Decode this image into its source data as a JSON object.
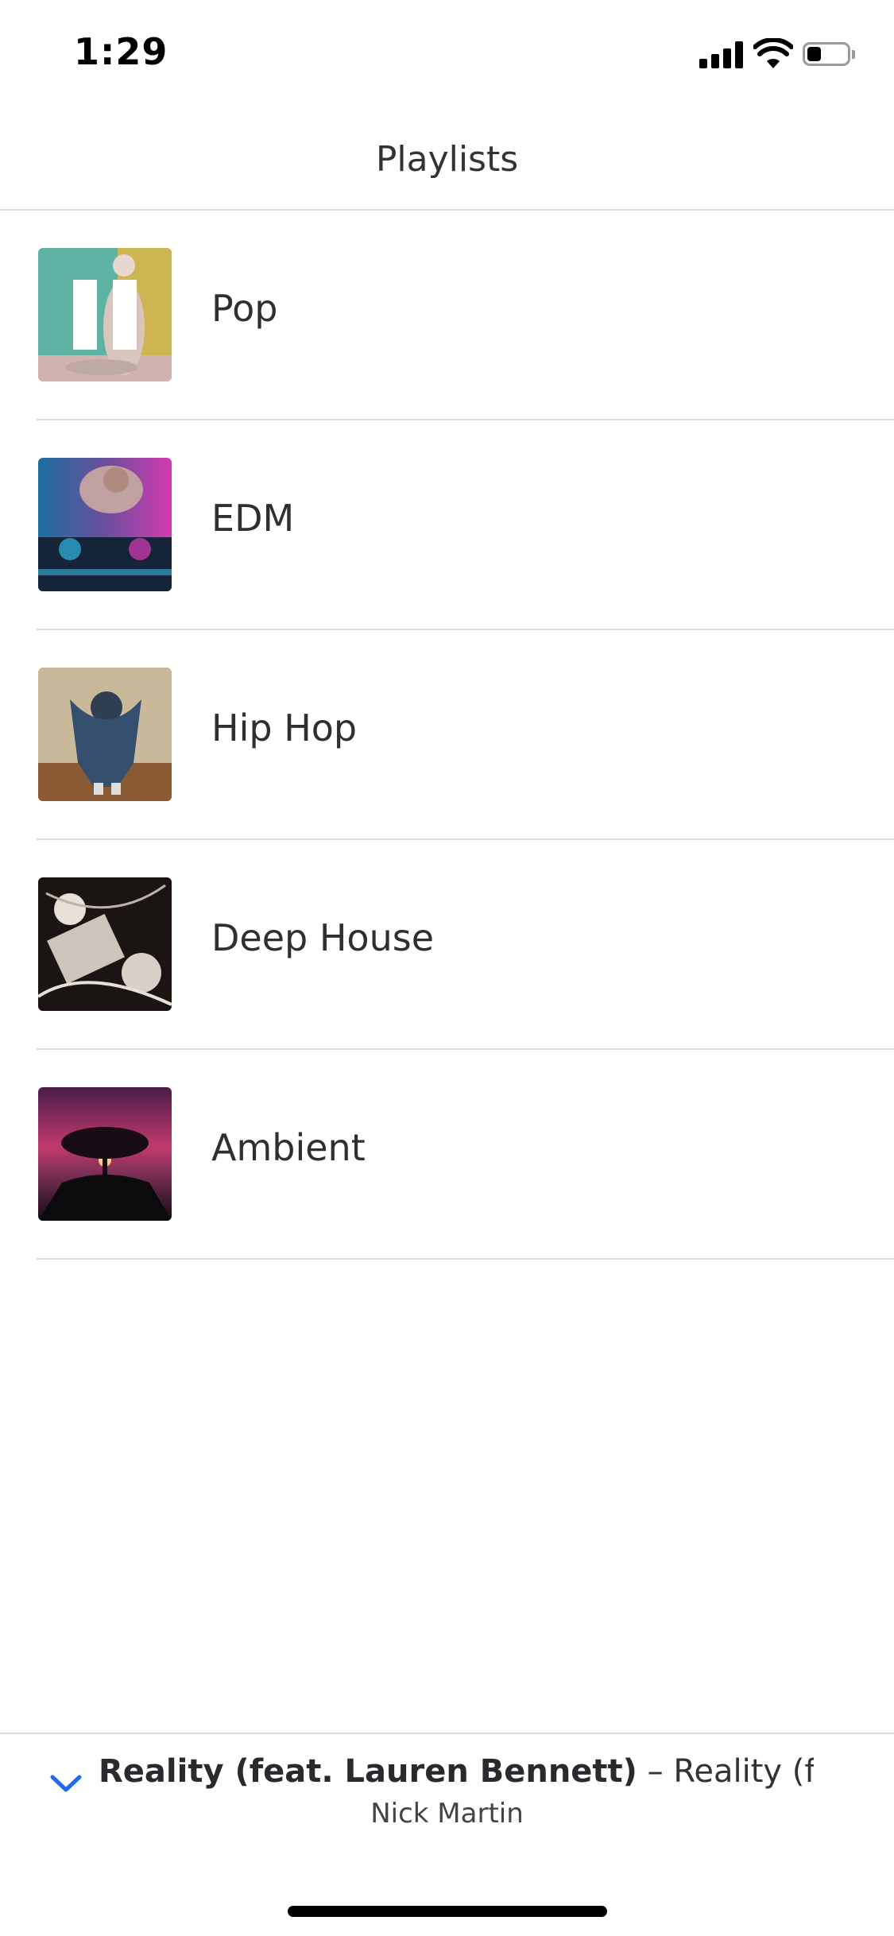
{
  "status_bar": {
    "time": "1:29",
    "battery_level": 0.35
  },
  "nav": {
    "title": "Playlists"
  },
  "playlists": [
    {
      "label": "Pop",
      "thumb_icon": "pause-icon",
      "playing": true
    },
    {
      "label": "EDM",
      "playing": false
    },
    {
      "label": "Hip Hop",
      "playing": false
    },
    {
      "label": "Deep House",
      "playing": false
    },
    {
      "label": "Ambient",
      "playing": false
    }
  ],
  "now_playing": {
    "track_title": "Reality (feat. Lauren Bennett)",
    "separator": " – ",
    "album_title": "Reality (feat....",
    "artist": "Nick Martin"
  },
  "colors": {
    "accent": "#1f6bf0",
    "divider": "#dcdcdc",
    "text": "#2f2f33"
  }
}
